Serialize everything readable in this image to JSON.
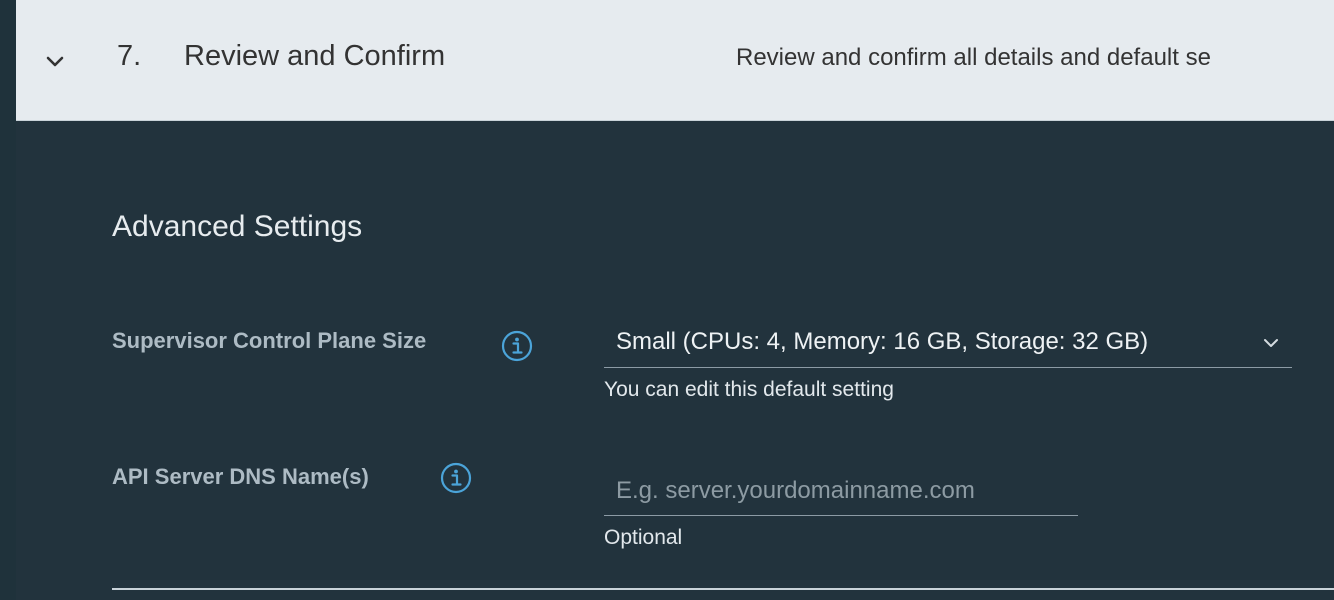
{
  "step": {
    "number": "7.",
    "title": "Review and Confirm",
    "description": "Review and confirm all details and default se"
  },
  "section": {
    "title": "Advanced Settings"
  },
  "fields": {
    "control_plane_size": {
      "label": "Supervisor Control Plane Size",
      "value": "Small (CPUs: 4, Memory: 16 GB, Storage: 32 GB)",
      "helper": "You can edit this default setting"
    },
    "api_dns": {
      "label": "API Server DNS Name(s)",
      "placeholder": "E.g. server.yourdomainname.com",
      "value": "",
      "helper": "Optional"
    }
  },
  "icons": {
    "collapse": "chevron-down-icon",
    "info": "info-icon",
    "select": "chevron-down-icon"
  },
  "colors": {
    "header_bg": "#e6ebef",
    "content_bg": "#22333d",
    "info_icon": "#4ba4d9",
    "label": "#adbbc4"
  }
}
